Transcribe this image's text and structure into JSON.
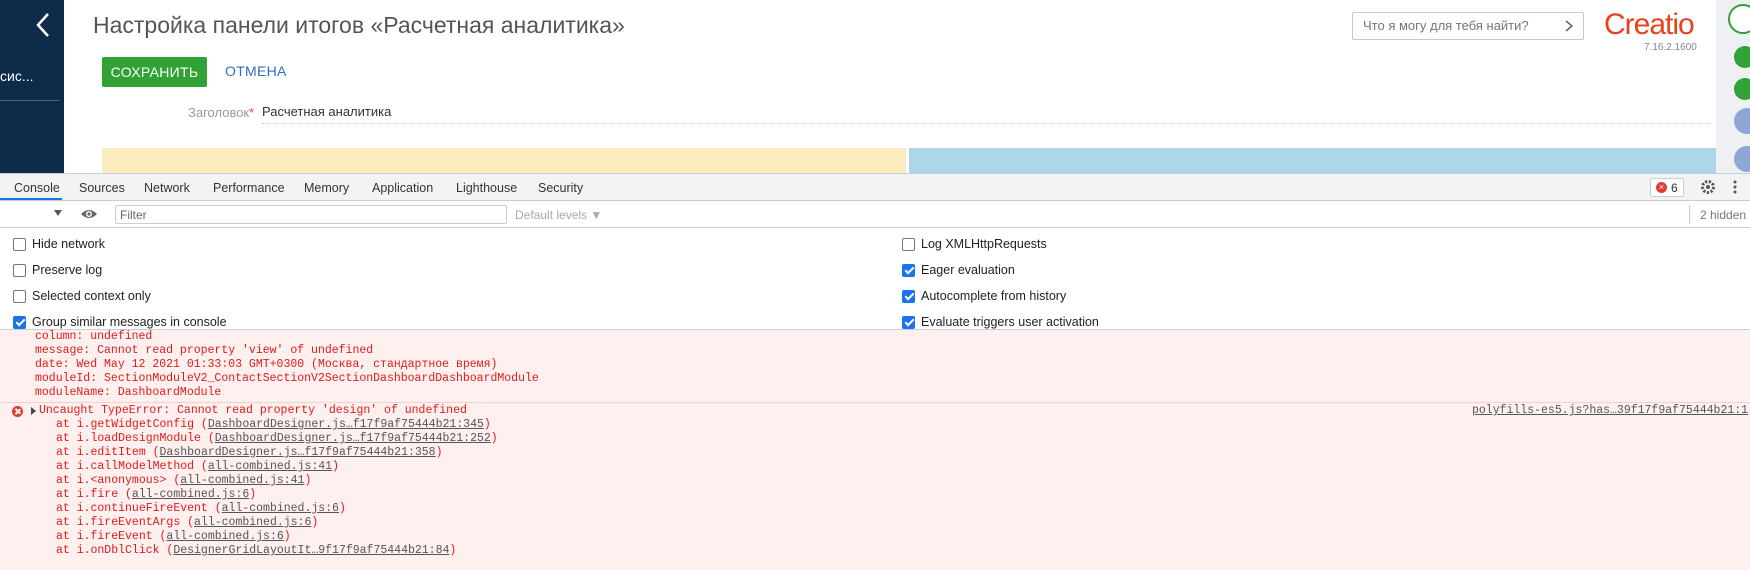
{
  "creatio": {
    "nav_section": "сис...",
    "page_title": "Настройка панели итогов «Расчетная аналитика»",
    "save_label": "СОХРАНИТЬ",
    "cancel_label": "ОТМЕНА",
    "caption_label": "Заголовок",
    "caption_required": "*",
    "caption_value": "Расчетная аналитика",
    "search_placeholder": "Что я могу для тебя найти?",
    "logo": "Creatio",
    "version": "7.16.2.1600"
  },
  "devtools": {
    "tabs": [
      "Console",
      "Sources",
      "Network",
      "Performance",
      "Memory",
      "Application",
      "Lighthouse",
      "Security"
    ],
    "active_tab": "Console",
    "error_count": "6",
    "filter_placeholder": "Filter",
    "levels_label": "Default levels ▼",
    "hidden_count": "2 hidden",
    "settings_left": [
      {
        "label": "Hide network",
        "checked": false
      },
      {
        "label": "Preserve log",
        "checked": false
      },
      {
        "label": "Selected context only",
        "checked": false
      },
      {
        "label": "Group similar messages in console",
        "checked": true
      }
    ],
    "settings_right": [
      {
        "label": "Log XMLHttpRequests",
        "checked": false
      },
      {
        "label": "Eager evaluation",
        "checked": true
      },
      {
        "label": "Autocomplete from history",
        "checked": true
      },
      {
        "label": "Evaluate triggers user activation",
        "checked": true
      }
    ]
  },
  "console": {
    "object_lines": [
      "column: undefined",
      "message: Cannot read property 'view' of undefined",
      "date: Wed May 12 2021 01:33:03 GMT+0300 (Москва, стандартное время)",
      "moduleId: SectionModuleV2_ContactSectionV2SectionDashboardDashboardModule",
      "moduleName: DashboardModule"
    ],
    "error_message": "Uncaught TypeError: Cannot read property 'design' of undefined",
    "error_source": "polyfills-es5.js?has…39f17f9af75444b21:1",
    "stack": [
      {
        "fn": "at i.getWidgetConfig (",
        "link": "DashboardDesigner.js…f17f9af75444b21:345",
        "end": ")"
      },
      {
        "fn": "at i.loadDesignModule (",
        "link": "DashboardDesigner.js…f17f9af75444b21:252",
        "end": ")"
      },
      {
        "fn": "at i.editItem (",
        "link": "DashboardDesigner.js…f17f9af75444b21:358",
        "end": ")"
      },
      {
        "fn": "at i.callModelMethod (",
        "link": "all-combined.js:41",
        "end": ")"
      },
      {
        "fn": "at i.<anonymous> (",
        "link": "all-combined.js:41",
        "end": ")"
      },
      {
        "fn": "at i.fire (",
        "link": "all-combined.js:6",
        "end": ")"
      },
      {
        "fn": "at i.continueFireEvent (",
        "link": "all-combined.js:6",
        "end": ")"
      },
      {
        "fn": "at i.fireEventArgs (",
        "link": "all-combined.js:6",
        "end": ")"
      },
      {
        "fn": "at i.fireEvent (",
        "link": "all-combined.js:6",
        "end": ")"
      },
      {
        "fn": "at i.onDblClick (",
        "link": "DesignerGridLayoutIt…9f17f9af75444b21:84",
        "end": ")"
      }
    ]
  },
  "colors": {
    "nav_bg": "#0f2b4a",
    "save_bg": "#31a336",
    "link_blue": "#2c6fbd",
    "logo_red": "#e8411e",
    "error_red": "#e01b1b",
    "error_bg": "#fff0f0",
    "devtools_accent": "#1a73e8"
  }
}
